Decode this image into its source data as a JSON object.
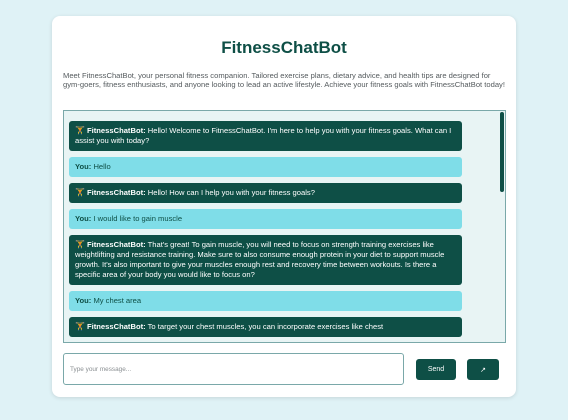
{
  "app": {
    "title": "FitnessChatBot",
    "intro": "Meet FitnessChatBot, your personal fitness companion. Tailored exercise plans, dietary advice, and health tips are designed for gym-goers, fitness enthusiasts, and anyone looking to lead an active lifestyle. Achieve your fitness goals with FitnessChatBot today!"
  },
  "bot_icon": {
    "name": "dumbbell-icon",
    "glyph": "🏋"
  },
  "messages": [
    {
      "role": "bot",
      "sender": "FitnessChatBot:",
      "text": "Hello! Welcome to FitnessChatBot. I'm here to help you with your fitness goals. What can I assist you with today?"
    },
    {
      "role": "user",
      "sender": "You:",
      "text": "Hello"
    },
    {
      "role": "bot",
      "sender": "FitnessChatBot:",
      "text": "Hello! How can I help you with your fitness goals?"
    },
    {
      "role": "user",
      "sender": "You:",
      "text": "I would like to gain muscle"
    },
    {
      "role": "bot",
      "sender": "FitnessChatBot:",
      "text": "That's great! To gain muscle, you will need to focus on strength training exercises like weightlifting and resistance training. Make sure to also consume enough protein in your diet to support muscle growth. It's also important to give your muscles enough rest and recovery time between workouts. Is there a specific area of your body you would like to focus on?"
    },
    {
      "role": "user",
      "sender": "You:",
      "text": "My chest area"
    },
    {
      "role": "bot",
      "sender": "FitnessChatBot:",
      "text": "To target your chest muscles, you can incorporate exercises like chest"
    }
  ],
  "input": {
    "placeholder": "Type your message...",
    "value": ""
  },
  "buttons": {
    "send_label": "Send",
    "voice_glyph": "↗"
  },
  "colors": {
    "brand": "#0e4f46",
    "user_bubble": "#7fdde8",
    "page_bg": "#dff2f6"
  }
}
